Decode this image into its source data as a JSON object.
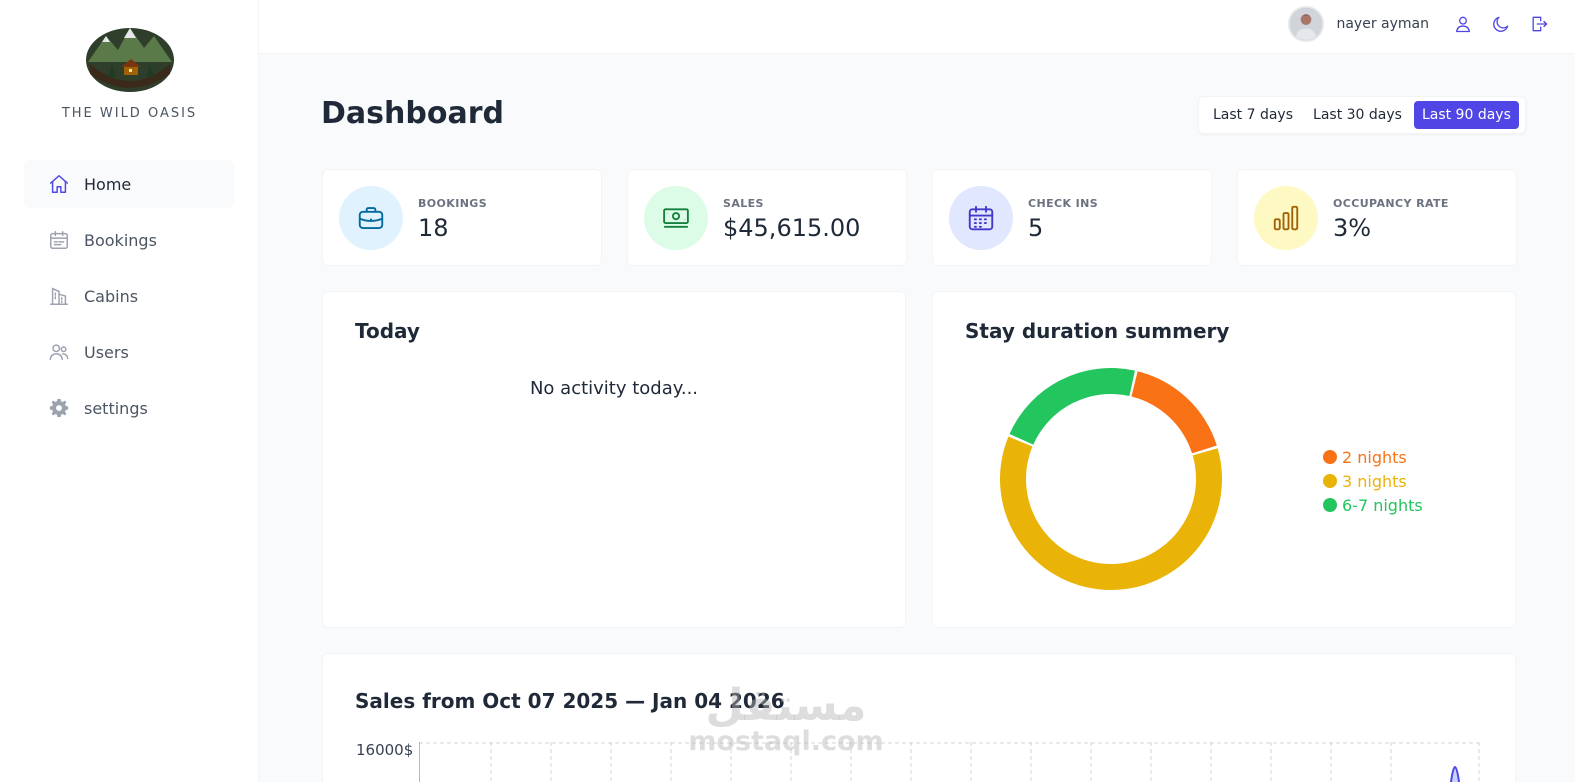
{
  "brand": {
    "name": "THE WILD OASIS"
  },
  "sidebar": {
    "items": [
      {
        "label": "Home",
        "icon": "home-icon",
        "active": true
      },
      {
        "label": "Bookings",
        "icon": "calendar-icon"
      },
      {
        "label": "Cabins",
        "icon": "building-icon"
      },
      {
        "label": "Users",
        "icon": "users-icon"
      },
      {
        "label": "settings",
        "icon": "gear-icon"
      }
    ]
  },
  "header": {
    "username": "nayer ayman"
  },
  "page": {
    "title": "Dashboard"
  },
  "filters": {
    "options": [
      "Last 7 days",
      "Last 30 days",
      "Last 90 days"
    ],
    "active": "Last 90 days"
  },
  "stats": [
    {
      "label": "BOOKINGS",
      "value": "18",
      "icon": "briefcase-icon",
      "bg": "#e0f2fe",
      "color": "#0369a1"
    },
    {
      "label": "SALES",
      "value": "$45,615.00",
      "icon": "banknotes-icon",
      "bg": "#dcfce7",
      "color": "#15803d"
    },
    {
      "label": "CHECK INS",
      "value": "5",
      "icon": "calendar-days-icon",
      "bg": "#e0e7ff",
      "color": "#4338ca"
    },
    {
      "label": "OCCUPANCY RATE",
      "value": "3%",
      "icon": "chart-bar-icon",
      "bg": "#fef9c3",
      "color": "#a16207"
    }
  ],
  "today": {
    "title": "Today",
    "empty_text": "No activity today..."
  },
  "stay": {
    "title": "Stay duration summery",
    "chart_data": {
      "type": "pie",
      "labels": [
        "2 nights",
        "3 nights",
        "6-7 nights"
      ],
      "values": [
        3,
        11,
        4
      ],
      "colors": [
        "#f97316",
        "#eab308",
        "#22c55e"
      ]
    }
  },
  "sales": {
    "title": "Sales from Oct 07 2025 — Jan 04 2026",
    "y_tick_top": "16000$"
  },
  "watermark": {
    "arabic": "مستقل",
    "latin": "mostaql.com"
  }
}
